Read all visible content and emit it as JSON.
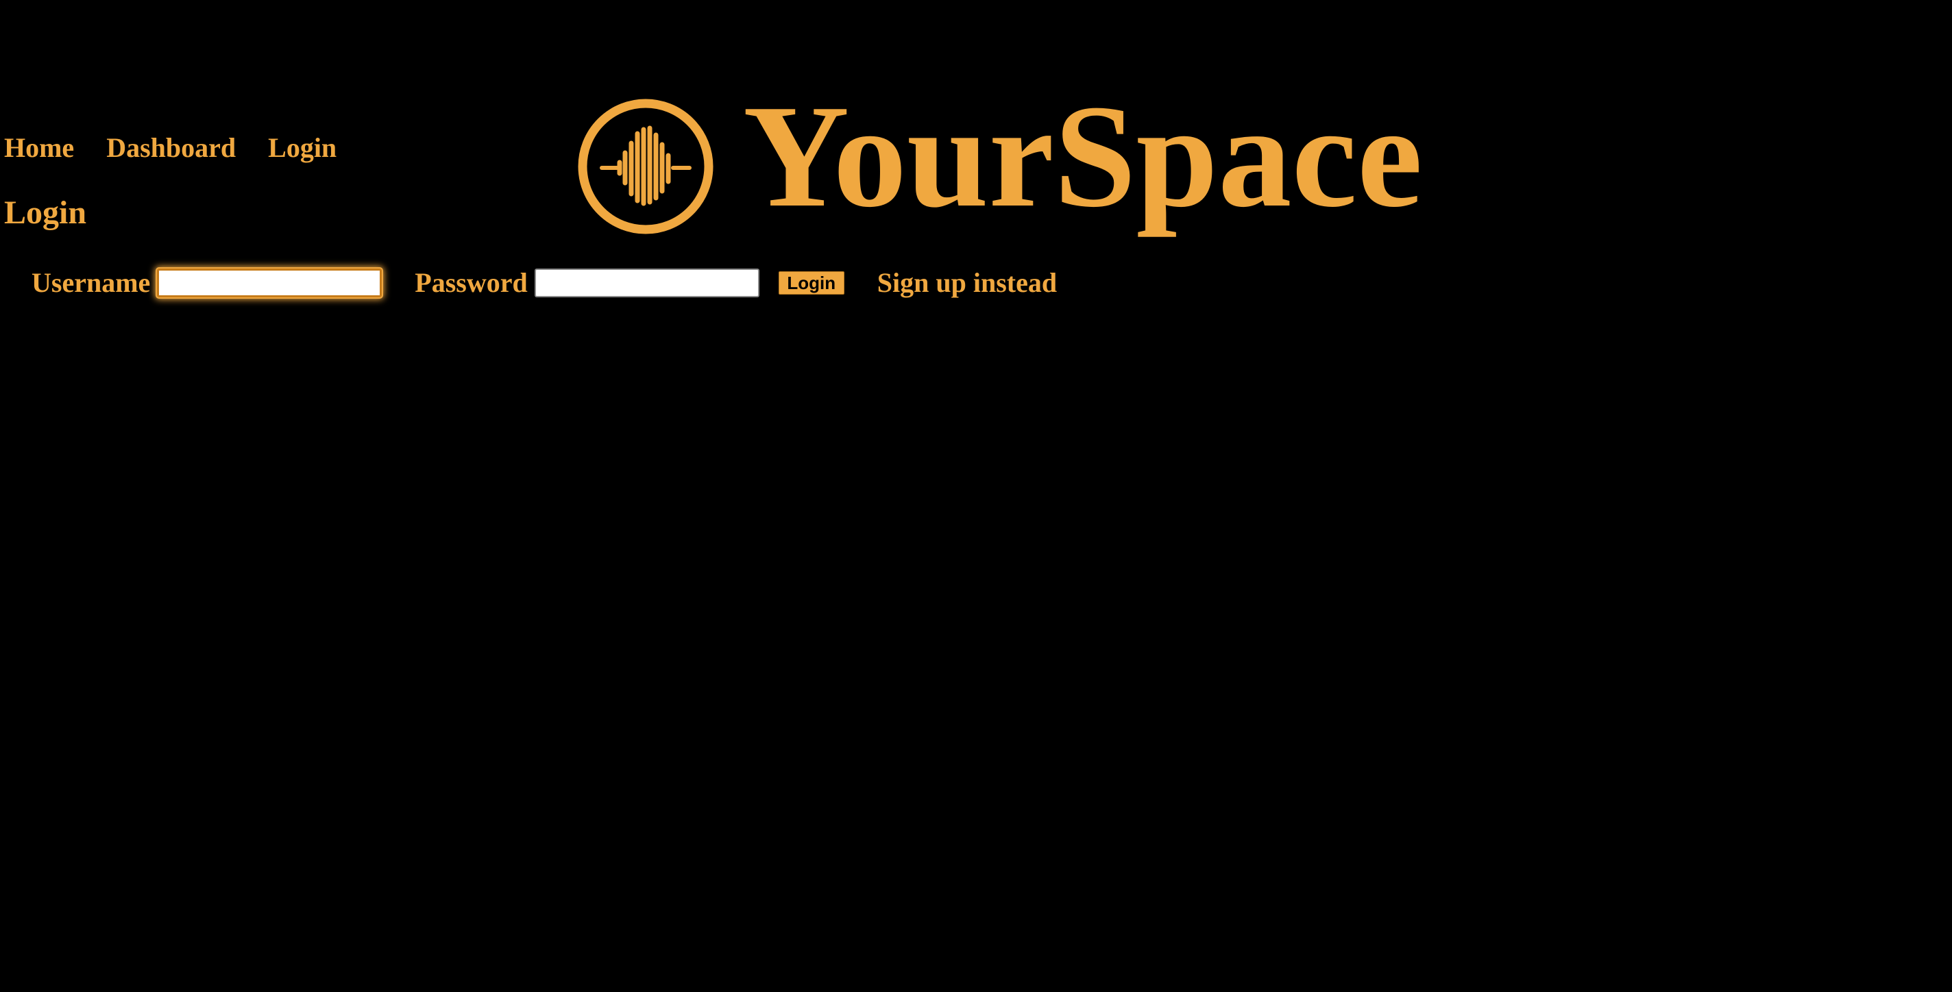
{
  "nav": {
    "items": [
      {
        "label": "Home"
      },
      {
        "label": "Dashboard"
      },
      {
        "label": "Login"
      }
    ]
  },
  "brand": {
    "name": "YourSpace",
    "logo_icon": "sound-wave-circle-icon"
  },
  "page": {
    "title": "Login"
  },
  "form": {
    "username_label": "Username",
    "username_value": "",
    "password_label": "Password",
    "password_value": "",
    "submit_label": "Login",
    "signup_link": "Sign up instead"
  },
  "colors": {
    "background": "#000000",
    "accent": "#f0a840",
    "input_background": "#ffffff",
    "button_text": "#000000"
  }
}
